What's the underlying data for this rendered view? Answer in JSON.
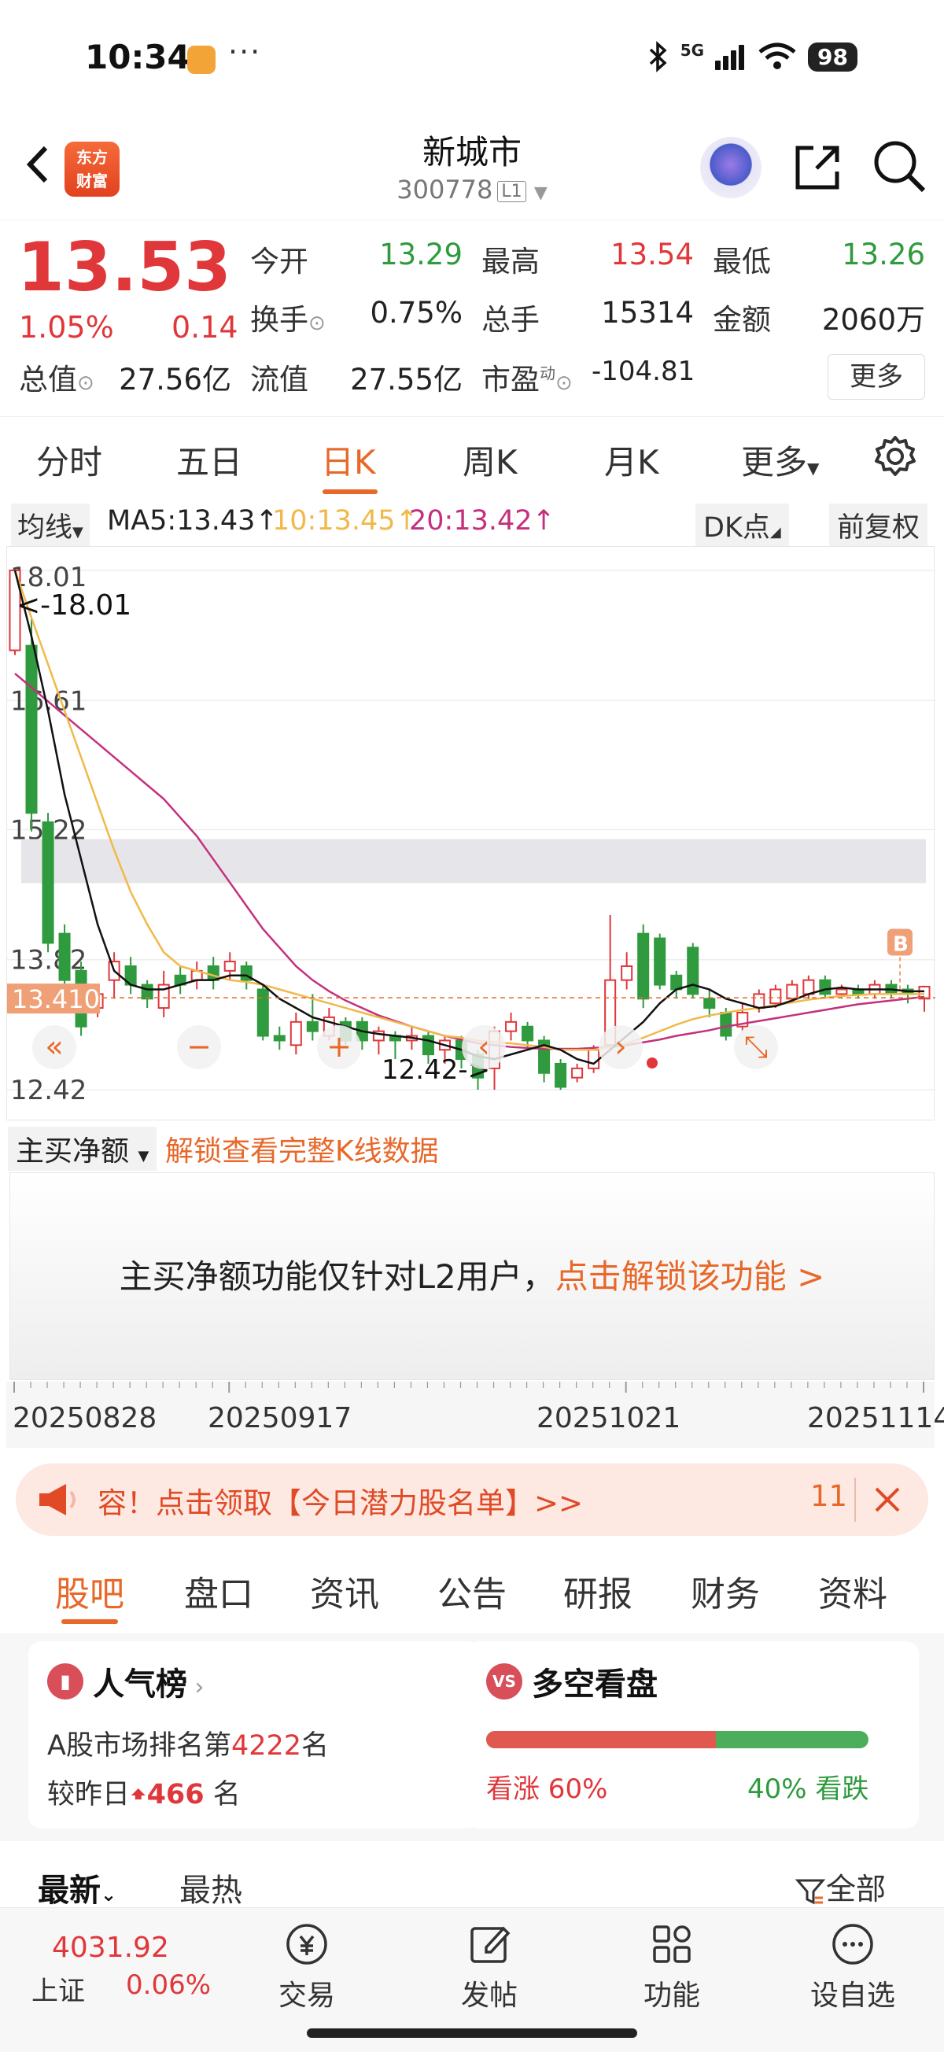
{
  "status": {
    "time": "10:34",
    "dots": "···",
    "network": "5G",
    "battery": "98"
  },
  "header": {
    "logo_line1": "东方",
    "logo_line2": "财富",
    "title": "新城市",
    "code": "300778",
    "level": "L1"
  },
  "quote": {
    "price": "13.53",
    "pct": "1.05%",
    "change": "0.14",
    "labels": {
      "open": "今开",
      "high": "最高",
      "low": "最低",
      "turnover": "换手",
      "volume": "总手",
      "amount": "金额",
      "mktcap": "总值",
      "float": "流值",
      "pe": "市盈",
      "pe_sup": "动"
    },
    "values": {
      "open": "13.29",
      "high": "13.54",
      "low": "13.26",
      "turnover": "0.75%",
      "volume": "15314",
      "amount": "2060万",
      "mktcap": "27.56亿",
      "float": "27.55亿",
      "pe": "-104.81"
    },
    "more": "更多"
  },
  "chart_tabs": [
    "分时",
    "五日",
    "日K",
    "周K",
    "月K",
    "更多"
  ],
  "ma": {
    "select": "均线",
    "ma5": "MA5:13.43",
    "ma10": "10:13.45",
    "ma20": "20:13.42",
    "dk": "DK点",
    "adjust": "前复权"
  },
  "chart_data": {
    "type": "candlestick",
    "y_ticks": [
      "18.01",
      "16.61",
      "15.22",
      "13.82",
      "12.42"
    ],
    "ylim": [
      12.42,
      18.01
    ],
    "current_price_label": "13.410",
    "high_marker": "<-18.01",
    "low_marker": "12.42->",
    "buy_marker": "B",
    "x_dates": [
      "20250828",
      "20250917",
      "20251021",
      "20251114"
    ],
    "candles": [
      {
        "o": 17.15,
        "c": 18.01,
        "h": 18.01,
        "l": 17.1
      },
      {
        "o": 17.2,
        "c": 15.4,
        "h": 17.5,
        "l": 15.2
      },
      {
        "o": 15.3,
        "c": 14.0,
        "h": 15.4,
        "l": 13.9
      },
      {
        "o": 14.1,
        "c": 13.6,
        "h": 14.2,
        "l": 13.5
      },
      {
        "o": 13.7,
        "c": 13.1,
        "h": 13.8,
        "l": 13.0
      },
      {
        "o": 13.3,
        "c": 13.45,
        "h": 13.55,
        "l": 13.2
      },
      {
        "o": 13.6,
        "c": 13.8,
        "h": 13.9,
        "l": 13.4
      },
      {
        "o": 13.75,
        "c": 13.55,
        "h": 13.85,
        "l": 13.45
      },
      {
        "o": 13.55,
        "c": 13.4,
        "h": 13.6,
        "l": 13.3
      },
      {
        "o": 13.3,
        "c": 13.55,
        "h": 13.7,
        "l": 13.2
      },
      {
        "o": 13.65,
        "c": 13.55,
        "h": 13.75,
        "l": 13.45
      },
      {
        "o": 13.6,
        "c": 13.7,
        "h": 13.8,
        "l": 13.5
      },
      {
        "o": 13.75,
        "c": 13.6,
        "h": 13.85,
        "l": 13.5
      },
      {
        "o": 13.7,
        "c": 13.8,
        "h": 13.9,
        "l": 13.6
      },
      {
        "o": 13.75,
        "c": 13.6,
        "h": 13.8,
        "l": 13.5
      },
      {
        "o": 13.5,
        "c": 13.0,
        "h": 13.55,
        "l": 12.95
      },
      {
        "o": 13.0,
        "c": 12.95,
        "h": 13.1,
        "l": 12.85
      },
      {
        "o": 12.9,
        "c": 13.15,
        "h": 13.25,
        "l": 12.8
      },
      {
        "o": 13.15,
        "c": 13.05,
        "h": 13.45,
        "l": 12.95
      },
      {
        "o": 13.0,
        "c": 13.2,
        "h": 13.3,
        "l": 12.95
      },
      {
        "o": 13.15,
        "c": 12.95,
        "h": 13.2,
        "l": 12.9
      },
      {
        "o": 13.15,
        "c": 12.95,
        "h": 13.2,
        "l": 12.85
      },
      {
        "o": 12.95,
        "c": 13.05,
        "h": 13.1,
        "l": 12.8
      },
      {
        "o": 13.0,
        "c": 12.95,
        "h": 13.05,
        "l": 12.75
      },
      {
        "o": 12.95,
        "c": 13.0,
        "h": 13.1,
        "l": 12.85
      },
      {
        "o": 13.0,
        "c": 12.8,
        "h": 13.05,
        "l": 12.7
      },
      {
        "o": 12.85,
        "c": 12.95,
        "h": 13.0,
        "l": 12.7
      },
      {
        "o": 12.95,
        "c": 12.75,
        "h": 13.0,
        "l": 12.65
      },
      {
        "o": 12.8,
        "c": 12.55,
        "h": 12.85,
        "l": 12.42
      },
      {
        "o": 12.65,
        "c": 13.05,
        "h": 13.1,
        "l": 12.42
      },
      {
        "o": 13.05,
        "c": 13.15,
        "h": 13.25,
        "l": 12.95
      },
      {
        "o": 13.1,
        "c": 12.95,
        "h": 13.15,
        "l": 12.85
      },
      {
        "o": 12.95,
        "c": 12.6,
        "h": 13.0,
        "l": 12.5
      },
      {
        "o": 12.7,
        "c": 12.45,
        "h": 12.75,
        "l": 12.42
      },
      {
        "o": 12.55,
        "c": 12.65,
        "h": 12.7,
        "l": 12.5
      },
      {
        "o": 12.65,
        "c": 12.85,
        "h": 12.9,
        "l": 12.6
      },
      {
        "o": 12.9,
        "c": 13.6,
        "h": 14.3,
        "l": 12.85
      },
      {
        "o": 13.6,
        "c": 13.75,
        "h": 13.9,
        "l": 13.5
      },
      {
        "o": 14.1,
        "c": 13.4,
        "h": 14.2,
        "l": 13.3
      },
      {
        "o": 14.05,
        "c": 13.55,
        "h": 14.1,
        "l": 13.5
      },
      {
        "o": 13.65,
        "c": 13.5,
        "h": 13.7,
        "l": 13.4
      },
      {
        "o": 13.95,
        "c": 13.45,
        "h": 14.0,
        "l": 13.4
      },
      {
        "o": 13.4,
        "c": 13.3,
        "h": 13.5,
        "l": 13.2
      },
      {
        "o": 13.25,
        "c": 13.0,
        "h": 13.3,
        "l": 12.95
      },
      {
        "o": 13.1,
        "c": 13.25,
        "h": 13.35,
        "l": 13.05
      },
      {
        "o": 13.3,
        "c": 13.45,
        "h": 13.5,
        "l": 13.25
      },
      {
        "o": 13.35,
        "c": 13.5,
        "h": 13.55,
        "l": 13.3
      },
      {
        "o": 13.4,
        "c": 13.55,
        "h": 13.6,
        "l": 13.35
      },
      {
        "o": 13.45,
        "c": 13.6,
        "h": 13.65,
        "l": 13.4
      },
      {
        "o": 13.6,
        "c": 13.45,
        "h": 13.65,
        "l": 13.4
      },
      {
        "o": 13.45,
        "c": 13.5,
        "h": 13.55,
        "l": 13.4
      },
      {
        "o": 13.5,
        "c": 13.45,
        "h": 13.55,
        "l": 13.4
      },
      {
        "o": 13.45,
        "c": 13.55,
        "h": 13.6,
        "l": 13.4
      },
      {
        "o": 13.55,
        "c": 13.45,
        "h": 13.6,
        "l": 13.4
      },
      {
        "o": 13.5,
        "c": 13.45,
        "h": 13.55,
        "l": 13.35
      },
      {
        "o": 13.4,
        "c": 13.53,
        "h": 13.54,
        "l": 13.26
      }
    ],
    "ma5": [
      18.01,
      17.3,
      16.5,
      15.6,
      14.9,
      14.2,
      13.7,
      13.55,
      13.5,
      13.5,
      13.55,
      13.6,
      13.6,
      13.65,
      13.65,
      13.55,
      13.4,
      13.3,
      13.2,
      13.15,
      13.1,
      13.05,
      13.02,
      13.0,
      12.98,
      12.95,
      12.9,
      12.85,
      12.78,
      12.75,
      12.8,
      12.85,
      12.9,
      12.85,
      12.75,
      12.7,
      12.85,
      13.0,
      13.15,
      13.35,
      13.5,
      13.55,
      13.5,
      13.4,
      13.35,
      13.3,
      13.32,
      13.38,
      13.45,
      13.5,
      13.52,
      13.5,
      13.5,
      13.5,
      13.48,
      13.48
    ],
    "ma10": [
      18.01,
      17.5,
      17.0,
      16.5,
      16.0,
      15.5,
      15.0,
      14.55,
      14.2,
      13.9,
      13.75,
      13.7,
      13.65,
      13.6,
      13.58,
      13.55,
      13.5,
      13.45,
      13.4,
      13.35,
      13.3,
      13.25,
      13.2,
      13.15,
      13.1,
      13.05,
      13.0,
      12.98,
      12.95,
      12.93,
      12.92,
      12.9,
      12.88,
      12.85,
      12.85,
      12.85,
      12.88,
      12.92,
      12.98,
      13.05,
      13.12,
      13.18,
      13.22,
      13.25,
      13.28,
      13.3,
      13.33,
      13.36,
      13.39,
      13.41,
      13.43,
      13.44,
      13.45,
      13.45,
      13.45,
      13.45
    ],
    "ma20": [
      16.9,
      16.75,
      16.6,
      16.45,
      16.3,
      16.15,
      16.0,
      15.85,
      15.7,
      15.55,
      15.35,
      15.15,
      14.9,
      14.65,
      14.4,
      14.15,
      13.95,
      13.75,
      13.6,
      13.48,
      13.38,
      13.3,
      13.22,
      13.16,
      13.1,
      13.05,
      13.0,
      12.96,
      12.92,
      12.9,
      12.88,
      12.87,
      12.86,
      12.86,
      12.86,
      12.87,
      12.88,
      12.9,
      12.93,
      12.96,
      13.0,
      13.03,
      13.06,
      13.1,
      13.13,
      13.16,
      13.19,
      13.22,
      13.25,
      13.28,
      13.31,
      13.34,
      13.36,
      13.38,
      13.4,
      13.42
    ]
  },
  "indicator": {
    "select": "主买净额",
    "unlock": "解锁查看完整K线数据",
    "panel_text": "主买净额功能仅针对L2用户，",
    "panel_link": "点击解锁该功能 >"
  },
  "banner": {
    "text": "容！点击领取【今日潜力股名单】>>",
    "count": "11"
  },
  "content_tabs": [
    "股吧",
    "盘口",
    "资讯",
    "公告",
    "研报",
    "财务",
    "资料"
  ],
  "popularity": {
    "title": "人气榜",
    "rank_prefix": "A股市场排名第",
    "rank": "4222",
    "rank_suffix": "名",
    "change_prefix": "较昨日",
    "change": "466",
    "change_suffix": " 名"
  },
  "vote": {
    "title": "多空看盘",
    "icon_text": "VS",
    "bull": "看涨 60%",
    "bear": "40% 看跌",
    "bull_ratio": 0.6
  },
  "feed": {
    "latest": "最新",
    "hot": "最热",
    "filter": "全部"
  },
  "bottom": {
    "index_value": "4031.92",
    "index_name": "上证",
    "index_pct": "0.06%",
    "nav": [
      "交易",
      "发帖",
      "功能",
      "设自选"
    ]
  },
  "colors": {
    "up": "#e0373b",
    "down": "#2f9a3e",
    "accent": "#e8682a",
    "ma5": "#111111",
    "ma10": "#f0b94a",
    "ma20": "#c4307e"
  }
}
